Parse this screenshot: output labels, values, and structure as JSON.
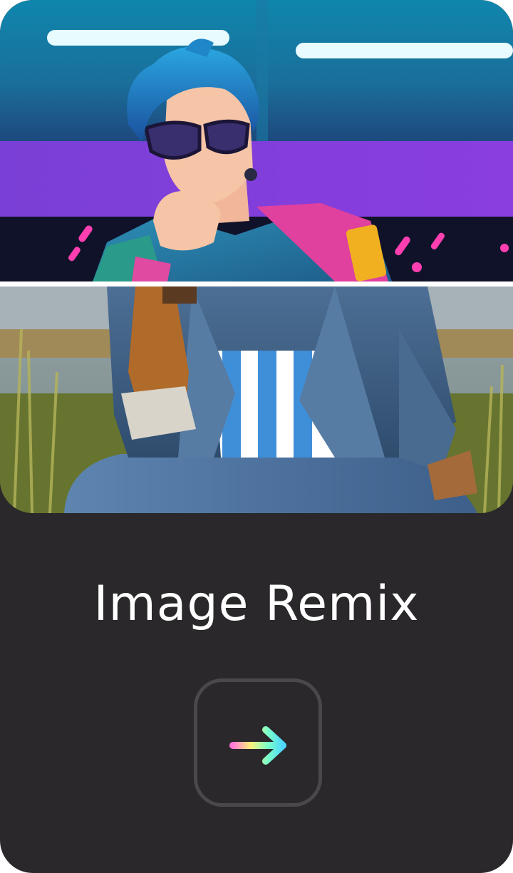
{
  "card": {
    "title": "Image Remix",
    "hero_images": [
      {
        "name": "anime-remix-image"
      },
      {
        "name": "original-photo-image"
      }
    ],
    "action": {
      "icon": "arrow-right-icon"
    }
  },
  "colors": {
    "card_background": "#2a282a",
    "button_border": "#4a484b",
    "title_text": "#ffffff",
    "arrow_gradient": [
      "#ff7ad9",
      "#fff07a",
      "#7affc9",
      "#4fd8ff"
    ]
  }
}
